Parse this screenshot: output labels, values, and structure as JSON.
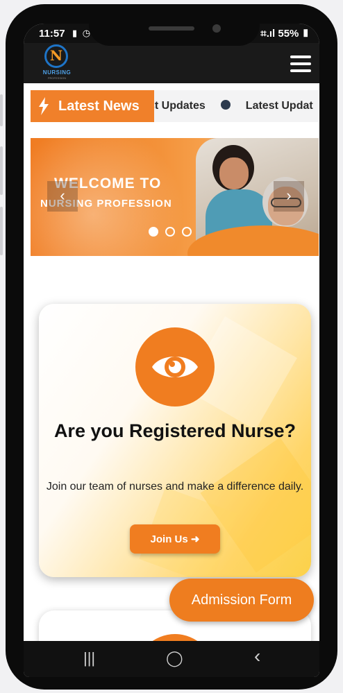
{
  "status_bar": {
    "time": "11:57",
    "battery": "55%",
    "signal_icons": "▮ ◷ ⚙",
    "right_icons": "⌗.ıl"
  },
  "header": {
    "logo_letter": "N",
    "logo_word": "NURSING",
    "logo_subword": "PROFESSION"
  },
  "ticker": {
    "badge_label": "Latest News",
    "items": [
      "st Updates",
      "Latest Updat"
    ]
  },
  "hero": {
    "title_line1": "WELCOME TO",
    "title_line2": "NURSING PROFESSION",
    "prev_label": "‹",
    "next_label": "›",
    "slide_count": 3,
    "active_slide": 0
  },
  "card": {
    "icon": "eye-icon",
    "title": "Are you Registered Nurse?",
    "description": "Join our team of nurses and make a difference daily.",
    "button_label": "Join Us"
  },
  "floating_button": {
    "label": "Admission Form"
  },
  "system_nav": {
    "recent": "|||",
    "home": "◯",
    "back": "‹"
  },
  "colors": {
    "accent": "#f07d20",
    "navbar": "#1a1a1a",
    "ticker_dot": "#2c3a4e"
  }
}
